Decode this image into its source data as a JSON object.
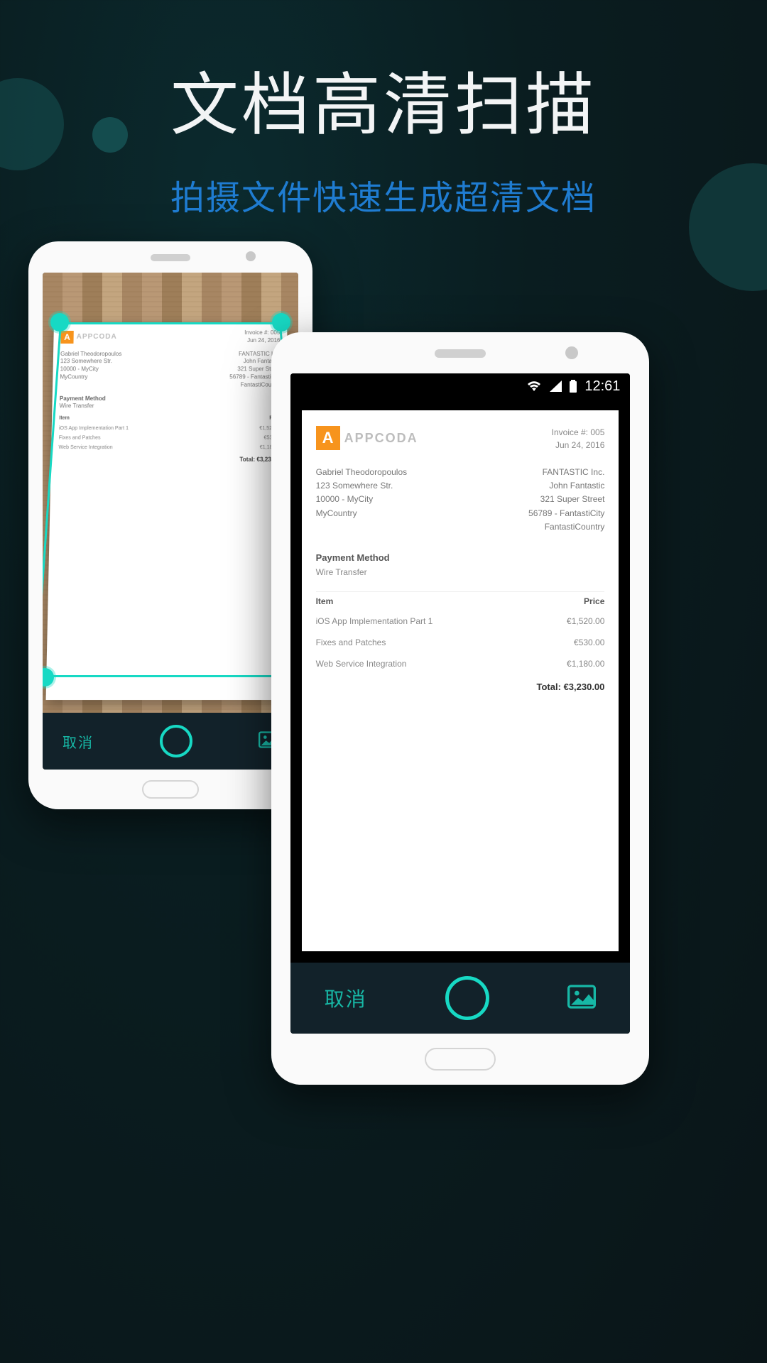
{
  "hero": {
    "title": "文档高清扫描",
    "subtitle": "拍摄文件快速生成超清文档"
  },
  "toolbar": {
    "cancel": "取消"
  },
  "statusbar": {
    "time": "12:61"
  },
  "invoice": {
    "logo_letter": "A",
    "logo_text": "APPCODA",
    "invoice_no_label": "Invoice #:",
    "invoice_no": "005",
    "date": "Jun 24, 2016",
    "from": {
      "name": "Gabriel Theodoropoulos",
      "line1": "123 Somewhere Str.",
      "line2": "10000 - MyCity",
      "line3": "MyCountry"
    },
    "to": {
      "name": "FANTASTIC Inc.",
      "line1": "John Fantastic",
      "line2": "321 Super Street",
      "line3": "56789 - FantastiCity",
      "line4": "FantastiCountry"
    },
    "payment_method_label": "Payment Method",
    "payment_method": "Wire Transfer",
    "col_item": "Item",
    "col_price": "Price",
    "items": [
      {
        "name": "iOS App Implementation Part 1",
        "price": "€1,520.00"
      },
      {
        "name": "Fixes and Patches",
        "price": "€530.00"
      },
      {
        "name": "Web Service Integration",
        "price": "€1,180.00"
      }
    ],
    "total_label": "Total:",
    "total": "€3,230.00"
  }
}
